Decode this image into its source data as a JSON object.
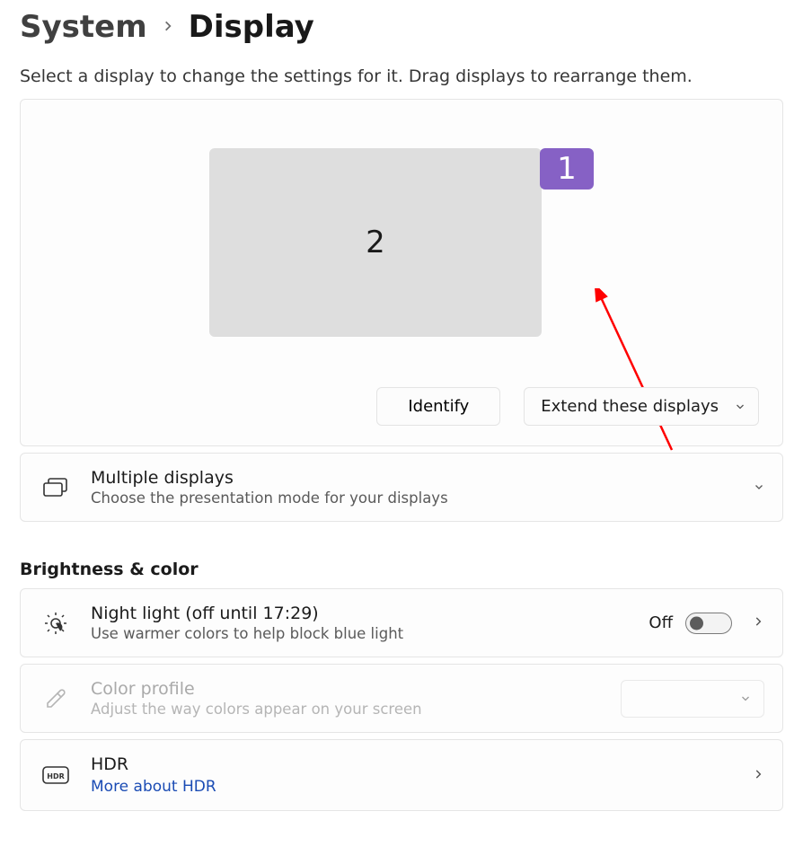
{
  "breadcrumb": {
    "parent": "System",
    "current": "Display"
  },
  "hint": "Select a display to change the settings for it. Drag displays to rearrange them.",
  "displays": {
    "box2": "2",
    "box1": "1"
  },
  "arrange": {
    "identify": "Identify",
    "mode_selected": "Extend these displays"
  },
  "rows": {
    "multiple": {
      "title": "Multiple displays",
      "sub": "Choose the presentation mode for your displays"
    },
    "night": {
      "title": "Night light (off until 17:29)",
      "sub": "Use warmer colors to help block blue light",
      "toggle_label": "Off"
    },
    "colorprofile": {
      "title": "Color profile",
      "sub": "Adjust the way colors appear on your screen"
    },
    "hdr": {
      "title": "HDR",
      "link": "More about HDR"
    }
  },
  "sections": {
    "brightness": "Brightness & color"
  }
}
